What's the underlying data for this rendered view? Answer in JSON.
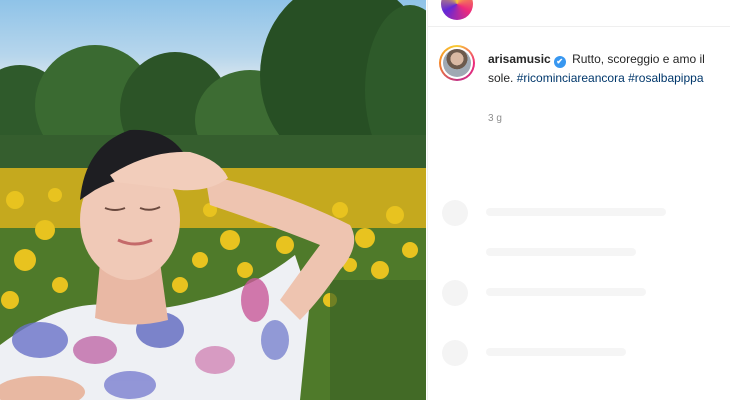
{
  "post": {
    "username": "arisamusic",
    "verified_icon": "✔",
    "caption_text": "Rutto, scoreggio e amo il sole.",
    "hashtags": [
      "#ricominciareancora",
      "#rosalbapippa"
    ],
    "time_ago": "3 g"
  },
  "colors": {
    "hashtag": "#00376b",
    "verified": "#3897f0",
    "time": "#8e8e8e"
  }
}
